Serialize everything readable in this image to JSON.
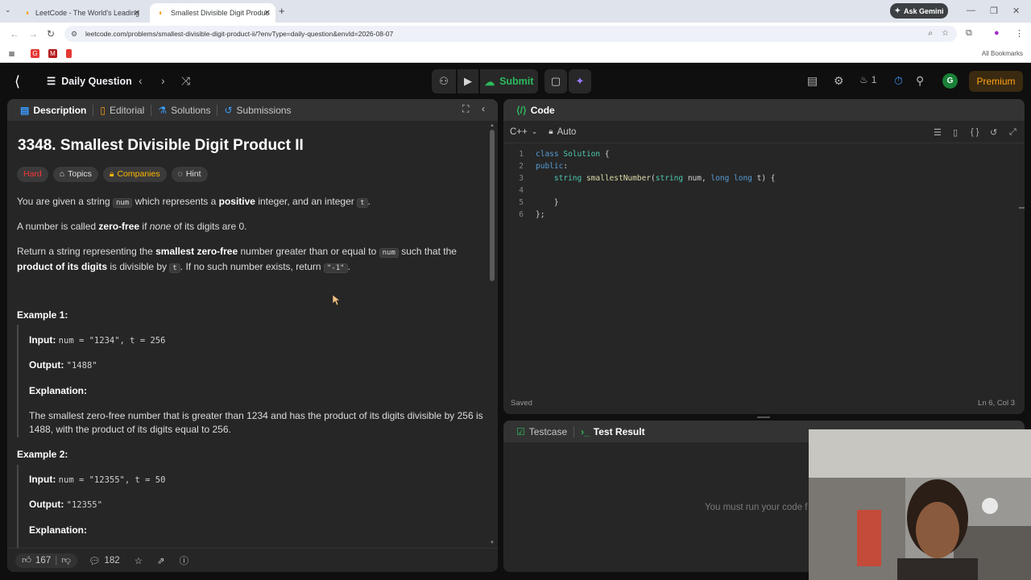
{
  "browser": {
    "tabs": [
      {
        "title": "LeetCode - The World's Leading",
        "active": false
      },
      {
        "title": "Smallest Divisible Digit Produc",
        "active": true
      }
    ],
    "url": "leetcode.com/problems/smallest-divisible-digit-product-ii/?envType=daily-question&envId=2026-08-07",
    "ask_gemini": "Ask Gemini",
    "all_bookmarks": "All Bookmarks"
  },
  "header": {
    "problem_list": "Daily Question",
    "submit": "Submit",
    "streak": "1",
    "avatar": "G",
    "premium": "Premium"
  },
  "description": {
    "tabs": [
      "Description",
      "Editorial",
      "Solutions",
      "Submissions"
    ],
    "title": "3348. Smallest Divisible Digit Product II",
    "chips": [
      "Hard",
      "Topics",
      "Companies",
      "Hint"
    ],
    "p1_a": "You are given a string ",
    "p1_code1": "num",
    "p1_b": " which represents a ",
    "p1_bold": "positive",
    "p1_c": " integer, and an integer ",
    "p1_code2": "t",
    "p1_d": ".",
    "p2_a": "A number is called ",
    "p2_bold": "zero-free",
    "p2_b": " if ",
    "p2_em": "none",
    "p2_c": " of its digits are 0.",
    "p3_a": "Return a string representing the ",
    "p3_bold": "smallest zero-free",
    "p3_b": " number greater than or equal to ",
    "p3_code1": "num",
    "p3_c": " such that the ",
    "p3_bold2": "product of its digits",
    "p3_d": " is divisible by ",
    "p3_code2": "t",
    "p3_e": ". If no such number exists, return ",
    "p3_code3": "\"-1\"",
    "p3_f": ".",
    "examples": [
      {
        "title": "Example 1:",
        "input_label": "Input:",
        "input": "num = \"1234\", t = 256",
        "output_label": "Output:",
        "output": "\"1488\"",
        "explanation_label": "Explanation:",
        "explanation_1": "The smallest zero-free number that is greater than 1234 and has the product of its digits divisible by 256 is",
        "explanation_2": "1488, with the product of its digits equal to 256."
      },
      {
        "title": "Example 2:",
        "input_label": "Input:",
        "input": "num = \"12355\", t = 50",
        "output_label": "Output:",
        "output": "\"12355\"",
        "explanation_label": "Explanation:"
      }
    ],
    "likes": "167",
    "comments": "182"
  },
  "code": {
    "tab": "Code",
    "language": "C++",
    "mode": "Auto",
    "line_numbers": [
      "1",
      "2",
      "3",
      "4",
      "5",
      "6"
    ],
    "status": "Saved",
    "cursor": "Ln 6, Col 3"
  },
  "tests": {
    "tab1": "Testcase",
    "tab2": "Test Result",
    "message": "You must run your code f"
  },
  "colors": {
    "accent": "#ffa116",
    "submit_green": "#2cbb5d",
    "hard_red": "#f63737"
  }
}
